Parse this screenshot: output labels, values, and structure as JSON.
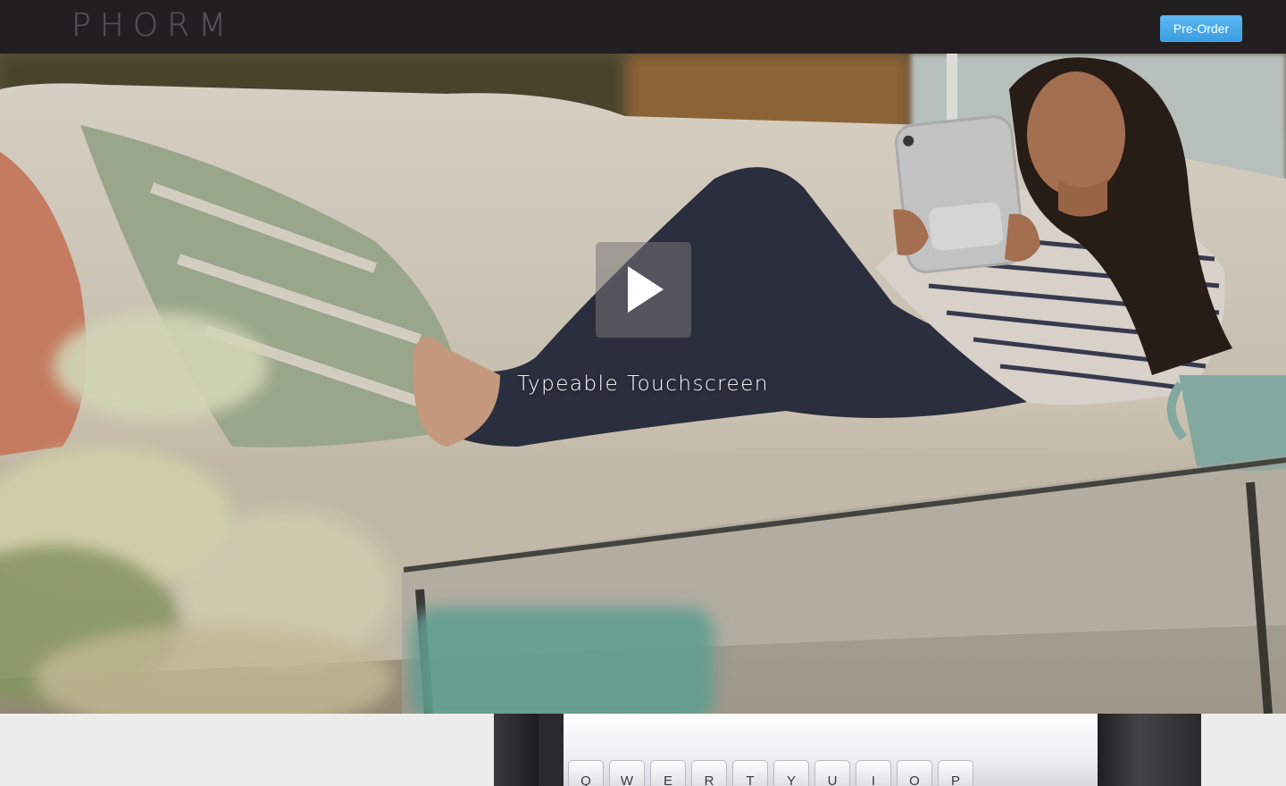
{
  "header": {
    "logo_text": "PHORM",
    "preorder_label": "Pre-Order"
  },
  "hero": {
    "caption": "Typeable Touchscreen",
    "play_icon": "play-icon"
  },
  "device_preview": {
    "keys": [
      "Q",
      "W",
      "E",
      "R",
      "T",
      "Y",
      "U",
      "I",
      "O",
      "P"
    ]
  },
  "colors": {
    "topbar": "#221f21",
    "logo": "#56545a",
    "button": "#3b9ee2",
    "section_bg": "#ecedeb"
  }
}
